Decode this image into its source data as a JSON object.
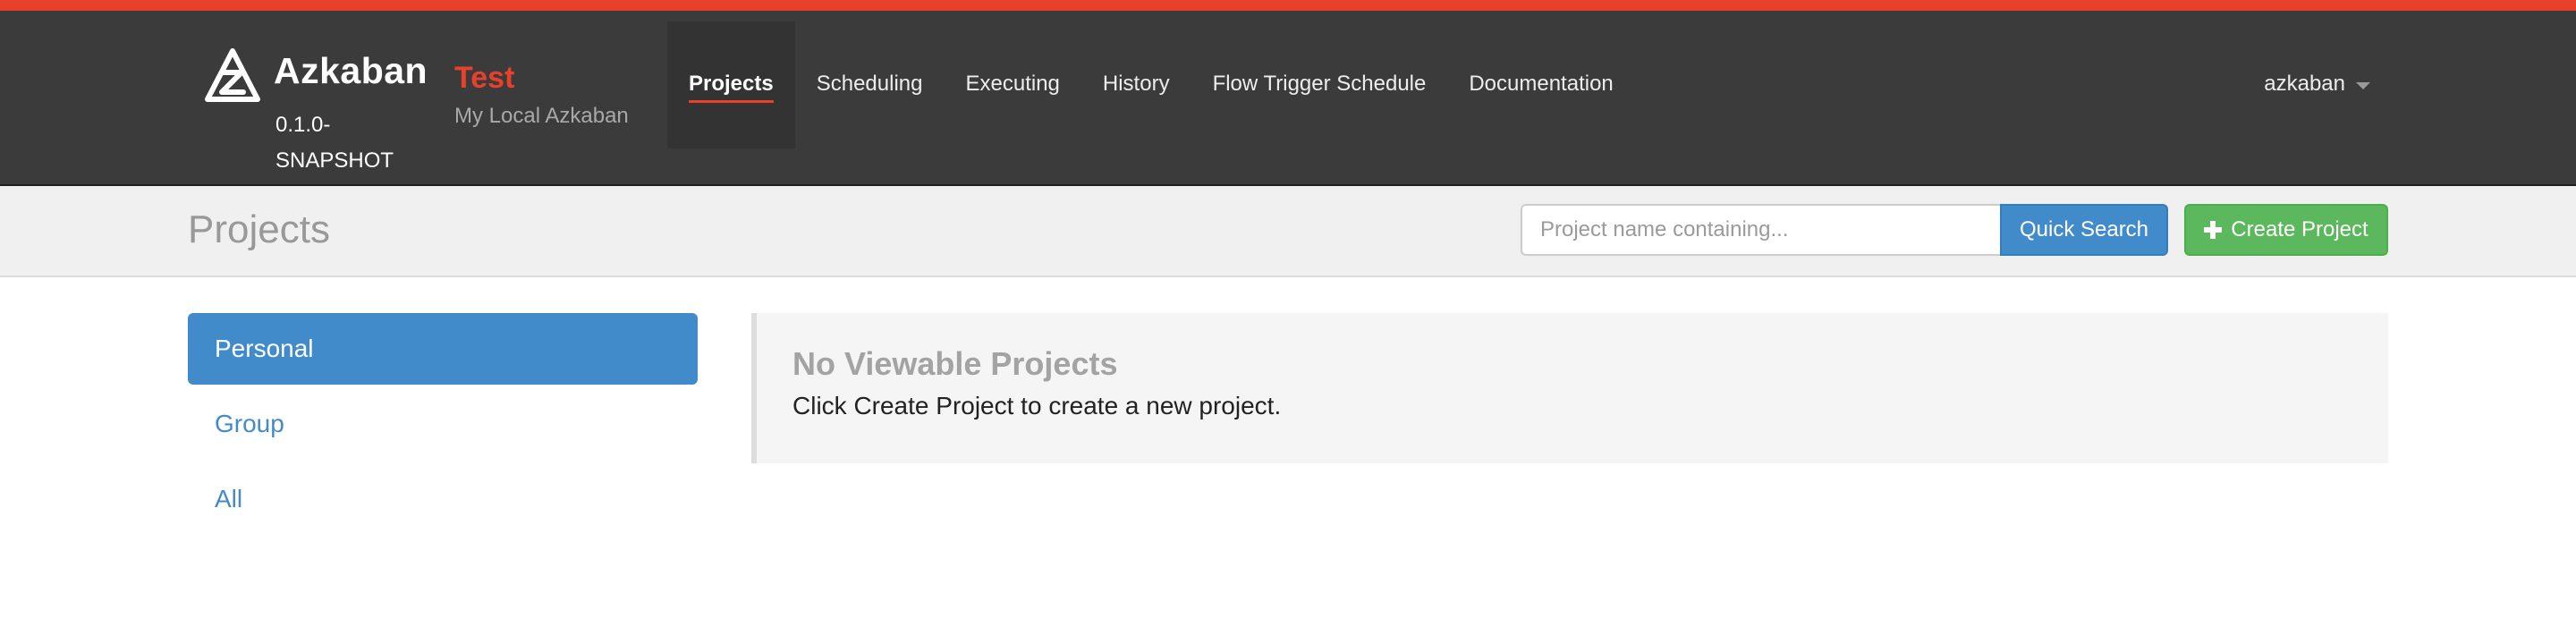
{
  "brand": {
    "name": "Azkaban",
    "version": "0.1.0-SNAPSHOT",
    "env_name": "Test",
    "env_description": "My Local Azkaban",
    "accent_color": "#e8402a"
  },
  "nav": {
    "tabs": [
      {
        "label": "Projects",
        "active": true
      },
      {
        "label": "Scheduling",
        "active": false
      },
      {
        "label": "Executing",
        "active": false
      },
      {
        "label": "History",
        "active": false
      },
      {
        "label": "Flow Trigger Schedule",
        "active": false
      },
      {
        "label": "Documentation",
        "active": false
      }
    ]
  },
  "user": {
    "name": "azkaban"
  },
  "header": {
    "title": "Projects",
    "search_placeholder": "Project name containing...",
    "search_value": "",
    "quick_search_label": "Quick Search",
    "create_project_label": "Create Project"
  },
  "sidebar": {
    "items": [
      {
        "label": "Personal",
        "active": true
      },
      {
        "label": "Group",
        "active": false
      },
      {
        "label": "All",
        "active": false
      }
    ]
  },
  "main": {
    "empty_title": "No Viewable Projects",
    "empty_text": "Click Create Project to create a new project."
  },
  "icons": {
    "logo": "azkaban-logo-icon",
    "user_menu": "caret-down-icon",
    "create": "plus-icon"
  },
  "colors": {
    "navbar": "#3b3b3b",
    "primary": "#428bca",
    "success": "#5cb85c"
  }
}
